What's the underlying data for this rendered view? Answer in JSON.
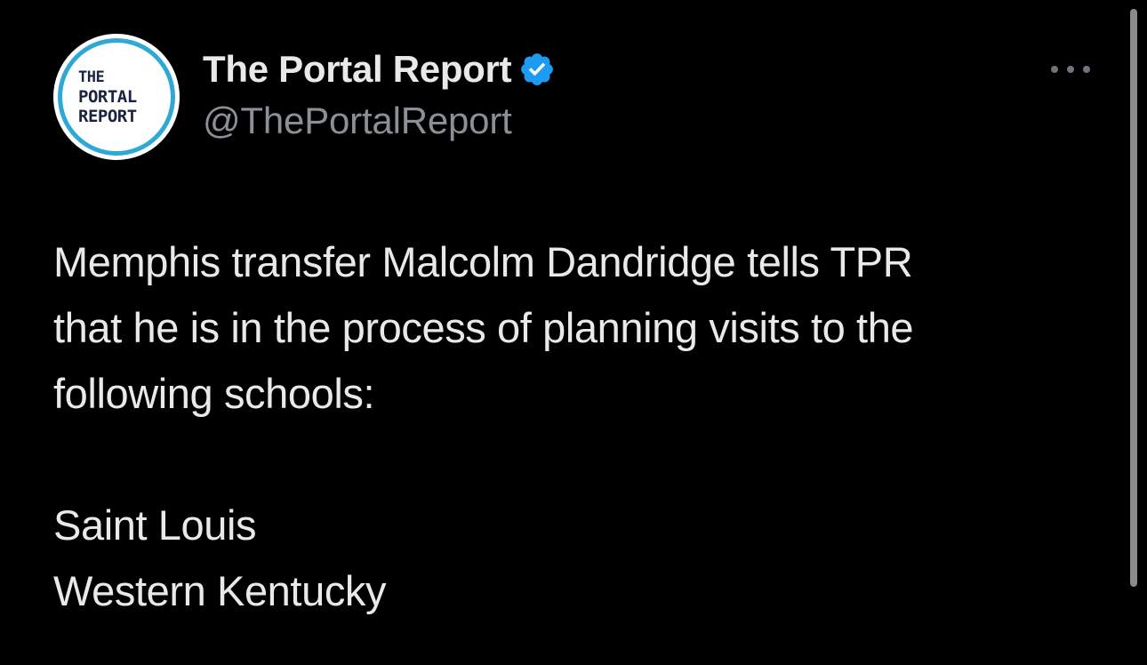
{
  "account": {
    "display_name": "The Portal Report",
    "handle": "@ThePortalReport",
    "verified": true,
    "avatar_logo_lines": [
      "THE",
      "PORTAL",
      "REPORT"
    ]
  },
  "tweet": {
    "lines": [
      "Memphis transfer Malcolm Dandridge tells TPR",
      "that he is in the process of planning visits to the",
      "following schools:"
    ],
    "schools": [
      "Saint Louis",
      "Western Kentucky"
    ]
  },
  "icons": {
    "verified": "verified-badge-icon",
    "more": "more-options-icon"
  },
  "colors": {
    "background": "#000000",
    "text_primary": "#e7e9ea",
    "text_secondary": "#8b9096",
    "verified_blue": "#1d9bf0",
    "avatar_ring": "#2ea9d6"
  }
}
